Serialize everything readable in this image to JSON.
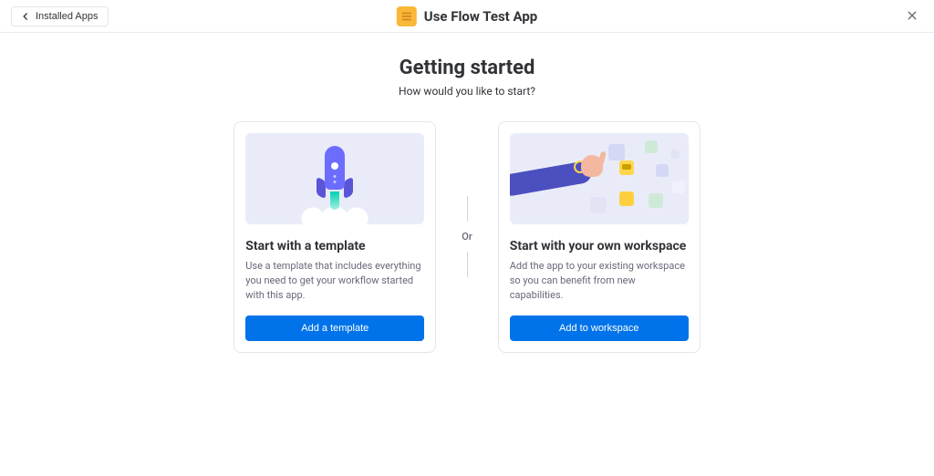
{
  "topbar": {
    "back_label": "Installed Apps",
    "app_title": "Use Flow Test App"
  },
  "page": {
    "heading": "Getting started",
    "subheading": "How would you like to start?",
    "separator_label": "Or"
  },
  "cards": {
    "template": {
      "title": "Start with a template",
      "desc": "Use a template that includes everything you need to get your workflow started with this app.",
      "button": "Add a template"
    },
    "workspace": {
      "title": "Start with your own workspace",
      "desc": "Add the app to your existing workspace so you can benefit from new capabilities.",
      "button": "Add to workspace"
    }
  }
}
